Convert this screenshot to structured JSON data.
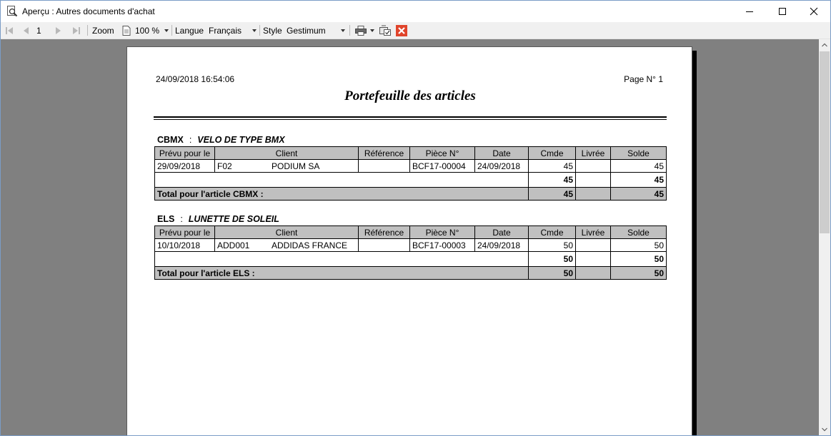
{
  "window": {
    "title": "Aperçu : Autres documents d'achat"
  },
  "toolbar": {
    "page_number": "1",
    "zoom_label": "Zoom",
    "zoom_value": "100 %",
    "language_label": "Langue",
    "language_value": "Français",
    "style_label": "Style",
    "style_value": "Gestimum"
  },
  "report": {
    "datetime": "24/09/2018 16:54:06",
    "page_label": "Page N° 1",
    "title": "Portefeuille des articles",
    "columns": [
      "Prévu pour le",
      "Client",
      "Référence",
      "Pièce N°",
      "Date",
      "Cmde",
      "Livrée",
      "Solde"
    ],
    "sections": [
      {
        "code": "CBMX",
        "name": "VELO DE TYPE BMX",
        "rows": [
          {
            "prevu": "29/09/2018",
            "client_code": "F02",
            "client_name": "PODIUM SA",
            "reference": "",
            "piece": "BCF17-00004",
            "date": "24/09/2018",
            "cmde": "45",
            "livree": "",
            "solde": "45"
          }
        ],
        "subtotal": {
          "cmde": "45",
          "livree": "",
          "solde": "45"
        },
        "total_label": "Total pour l'article CBMX :",
        "total": {
          "cmde": "45",
          "livree": "",
          "solde": "45"
        }
      },
      {
        "code": "ELS",
        "name": "LUNETTE DE SOLEIL",
        "rows": [
          {
            "prevu": "10/10/2018",
            "client_code": "ADD001",
            "client_name": "ADDIDAS FRANCE",
            "reference": "",
            "piece": "BCF17-00003",
            "date": "24/09/2018",
            "cmde": "50",
            "livree": "",
            "solde": "50"
          }
        ],
        "subtotal": {
          "cmde": "50",
          "livree": "",
          "solde": "50"
        },
        "total_label": "Total pour l'article ELS :",
        "total": {
          "cmde": "50",
          "livree": "",
          "solde": "50"
        }
      }
    ]
  },
  "icons": {
    "app": "magnifier-document-icon",
    "first": "first-page-icon",
    "prev": "previous-page-icon",
    "next": "next-page-icon",
    "last": "last-page-icon",
    "page": "page-icon",
    "print": "printer-icon",
    "export": "export-icon",
    "close": "close-red-icon"
  },
  "colors": {
    "close_button": "#e0442b",
    "header_bg": "#c0c0c0",
    "viewer_bg": "#808080"
  }
}
